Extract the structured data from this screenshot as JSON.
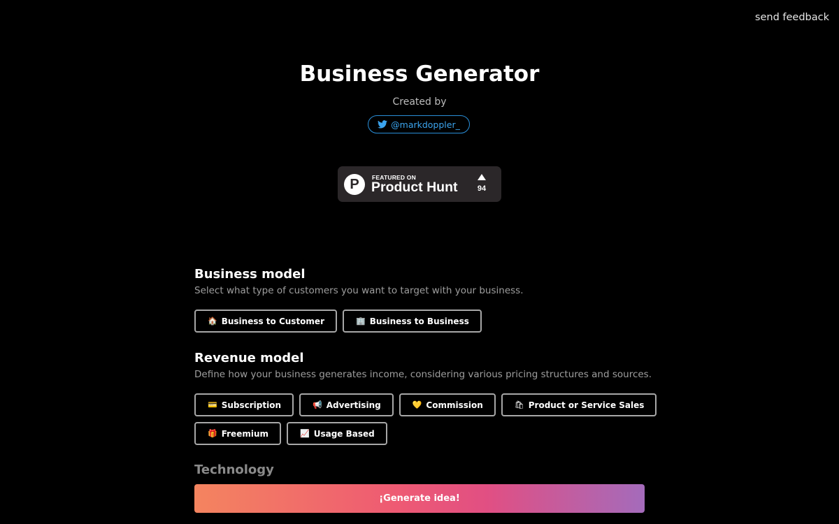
{
  "header": {
    "feedback_label": "send feedback"
  },
  "hero": {
    "title": "Business Generator",
    "created_by": "Created by",
    "twitter_handle": "@markdoppler_",
    "product_hunt": {
      "featured_label": "FEATURED ON",
      "name": "Product Hunt",
      "logo_letter": "P",
      "upvotes": "94"
    }
  },
  "business_model": {
    "title": "Business model",
    "description": "Select what type of customers you want to target with your business.",
    "options": [
      {
        "emoji": "🏠",
        "label": "Business to Customer"
      },
      {
        "emoji": "🏢",
        "label": "Business to Business"
      }
    ]
  },
  "revenue_model": {
    "title": "Revenue model",
    "description": "Define how your business generates income, considering various pricing structures and sources.",
    "options": [
      {
        "emoji": "💳",
        "label": "Subscription"
      },
      {
        "emoji": "📢",
        "label": "Advertising"
      },
      {
        "emoji": "💛",
        "label": "Commission"
      },
      {
        "emoji": "🛍",
        "label": "Product or Service Sales"
      },
      {
        "emoji": "🎁",
        "label": "Freemium"
      },
      {
        "emoji": "📈",
        "label": "Usage Based"
      }
    ]
  },
  "technology": {
    "title": "Technology"
  },
  "actions": {
    "generate_label": "¡Generate idea!"
  },
  "colors": {
    "background": "#000000",
    "twitter_blue": "#3ba4ee",
    "button_border": "#a7a7a7",
    "gradient_start": "#f4845f",
    "gradient_mid": "#e14f83",
    "gradient_end": "#a46bbb"
  },
  "icons": {
    "twitter": "twitter-bird-icon",
    "product_hunt_logo": "product-hunt-logo-icon",
    "upvote": "upvote-triangle-icon"
  }
}
